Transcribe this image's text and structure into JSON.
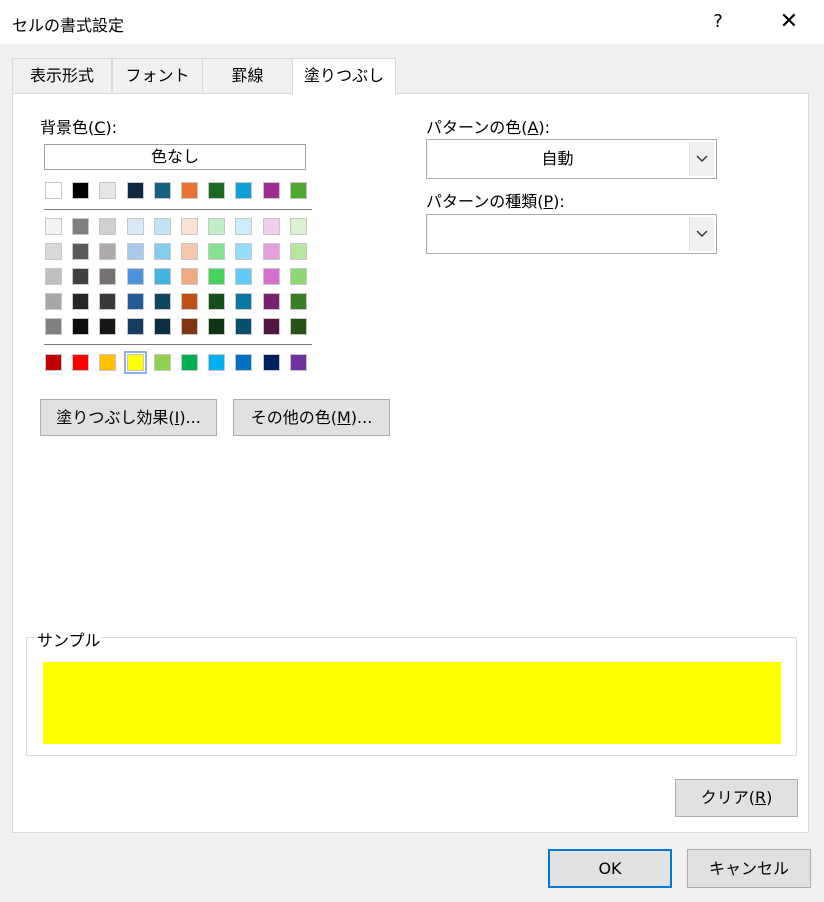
{
  "window": {
    "title": "セルの書式設定",
    "help": "?",
    "close": "✕"
  },
  "tabs": [
    {
      "label": "表示形式"
    },
    {
      "label": "フォント"
    },
    {
      "label": "罫線"
    },
    {
      "label": "塗りつぶし"
    }
  ],
  "background": {
    "label_prefix": "背景色(",
    "label_key": "C",
    "label_suffix": "):",
    "no_color": "色なし",
    "theme_top": [
      "#ffffff",
      "#000000",
      "#e7e6e6",
      "#0e2841",
      "#156082",
      "#e97132",
      "#196b24",
      "#0f9ed5",
      "#a02b93",
      "#4ea72e"
    ],
    "theme_rows": [
      [
        "#f2f2f2",
        "#7f7f7f",
        "#d0d0d0",
        "#dae9f8",
        "#c0e4f5",
        "#fbe2d5",
        "#c1f0c8",
        "#caeefb",
        "#f2ceef",
        "#daf2d0"
      ],
      [
        "#d9d9d9",
        "#595959",
        "#aeaaaa",
        "#a6c9ec",
        "#83cceb",
        "#f7c7ac",
        "#83e28e",
        "#94dcf8",
        "#e59edd",
        "#b5e6a2"
      ],
      [
        "#bfbfbf",
        "#404040",
        "#757171",
        "#4d93d9",
        "#44b3e1",
        "#f1a983",
        "#47d359",
        "#61cbf4",
        "#d86dcd",
        "#8ed973"
      ],
      [
        "#a6a6a6",
        "#262626",
        "#3a3838",
        "#215c98",
        "#0f4761",
        "#c04f15",
        "#124f1a",
        "#0b76a0",
        "#782170",
        "#3b7d23"
      ],
      [
        "#808080",
        "#0d0d0d",
        "#161616",
        "#153d64",
        "#0a2f40",
        "#7f3510",
        "#0c3511",
        "#074f6a",
        "#511644",
        "#275317"
      ]
    ],
    "standard": [
      "#c00000",
      "#ff0000",
      "#ffc000",
      "#ffff00",
      "#92d050",
      "#00b050",
      "#00b0f0",
      "#0070c0",
      "#002060",
      "#7030a0"
    ],
    "selected_standard_index": 3,
    "fill_effects_prefix": "塗りつぶし効果(",
    "fill_effects_key": "I",
    "fill_effects_suffix": ")...",
    "more_colors_prefix": "その他の色(",
    "more_colors_key": "M",
    "more_colors_suffix": ")..."
  },
  "pattern": {
    "color_label_prefix": "パターンの色(",
    "color_label_key": "A",
    "color_label_suffix": "):",
    "color_value": "自動",
    "style_label_prefix": "パターンの種類(",
    "style_label_key": "P",
    "style_label_suffix": "):",
    "style_value": ""
  },
  "sample": {
    "label": "サンプル",
    "color": "#ffff00"
  },
  "clear": {
    "prefix": "クリア(",
    "key": "R",
    "suffix": ")"
  },
  "footer": {
    "ok": "OK",
    "cancel": "キャンセル"
  }
}
